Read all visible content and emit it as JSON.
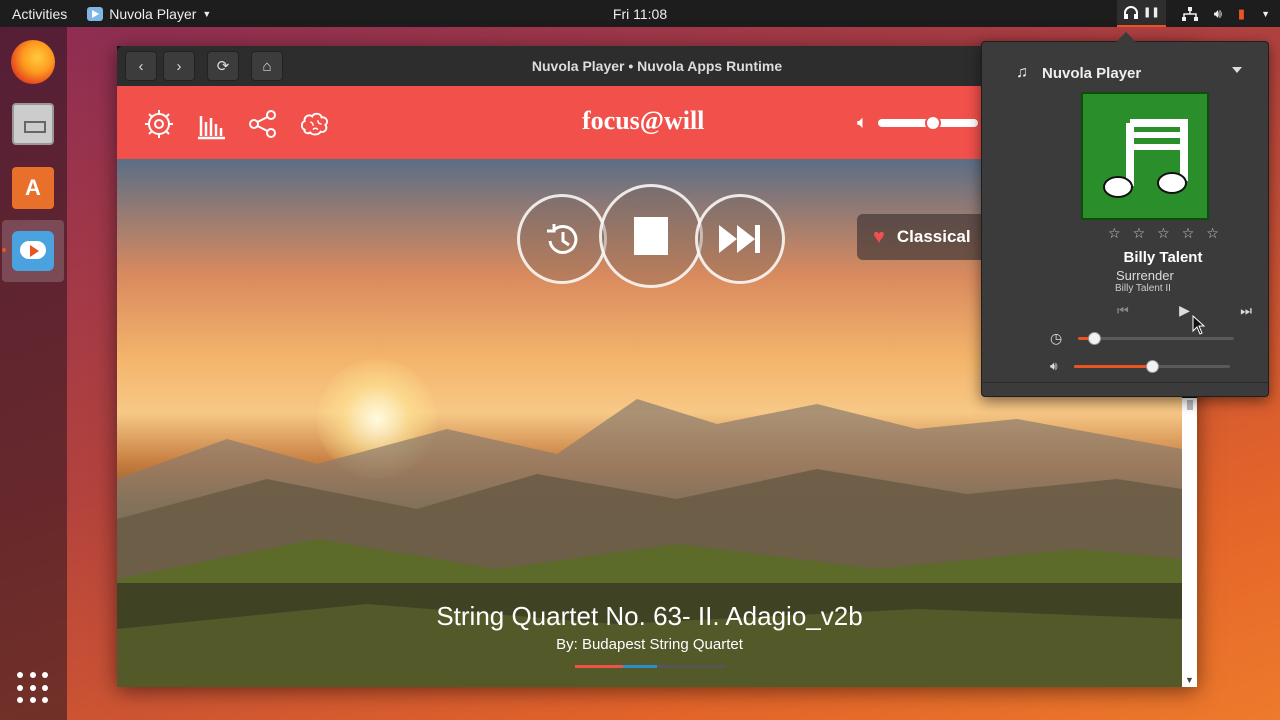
{
  "topbar": {
    "activities": "Activities",
    "app_menu": "Nuvola Player",
    "clock": "Fri 11:08"
  },
  "window": {
    "title": "Nuvola Player • Nuvola Apps Runtime"
  },
  "focuswill": {
    "logo": "focus@will",
    "genre": "Classical",
    "volume_level": 0.55,
    "track_title": "String Quartet No. 63- II. Adagio_v2b",
    "track_artist": "By: Budapest String Quartet",
    "progress_fraction": 0.55
  },
  "popover": {
    "app_name": "Nuvola Player",
    "artist": "Billy Talent",
    "song": "Surrender",
    "album": "Billy Talent II",
    "rating_stars": 5,
    "position_fraction": 0.1,
    "volume_fraction": 0.5
  },
  "colors": {
    "accent": "#e95420",
    "focuswill_red": "#f2504b",
    "art_green": "#2a8f2a"
  },
  "icons": [
    "firefox-icon",
    "files-icon",
    "software-icon",
    "nuvola-icon",
    "show-apps-icon"
  ]
}
